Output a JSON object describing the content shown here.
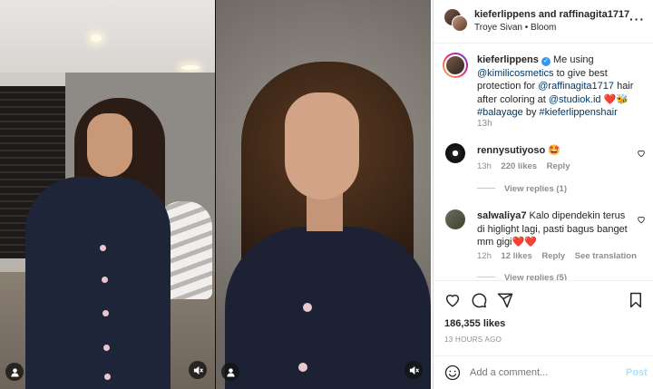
{
  "header": {
    "usernames": "kieferlippens and raffinagita1717",
    "audio": "Troye Sivan • Bloom"
  },
  "caption": {
    "username": "kieferlippens",
    "text_1": "Me using",
    "mention_1": "@kimilicosmetics",
    "text_2": " to give best protection for ",
    "mention_2": "@raffinagita1717",
    "text_3": " hair after coloring at ",
    "mention_3": "@studiok.id",
    "emoji": " ❤️🐝",
    "hashtag_1": "#balayage",
    "text_4": " by ",
    "hashtag_2": "#kieferlippenshair",
    "time": "13h"
  },
  "comments": [
    {
      "username": "rennysutiyoso",
      "text": "🤩",
      "time": "13h",
      "likes": "220 likes",
      "reply": "Reply",
      "view_replies": "View replies (1)"
    },
    {
      "username": "salwaliya7",
      "text": "Kalo dipendekin terus di higlight lagi, pasti bagus banget mm gigi❤️❤️",
      "time": "12h",
      "likes": "12 likes",
      "reply": "Reply",
      "translate": "See translation",
      "view_replies": "View replies (5)"
    }
  ],
  "stats": {
    "likes": "186,355 likes",
    "timestamp": "13 HOURS AGO"
  },
  "add_comment": {
    "placeholder": "Add a comment...",
    "post_label": "Post",
    "post_color": "#b2dffc"
  },
  "icons": {
    "like": "heart-icon",
    "comment": "comment-icon",
    "share": "share-icon",
    "save": "bookmark-icon",
    "more": "more-icon",
    "emoji": "emoji-icon",
    "user_tag": "user-tag-icon",
    "mute": "mute-icon"
  },
  "colors": {
    "link": "#00376b",
    "verified": "#3897f0",
    "muted": "#8e8e8e"
  }
}
